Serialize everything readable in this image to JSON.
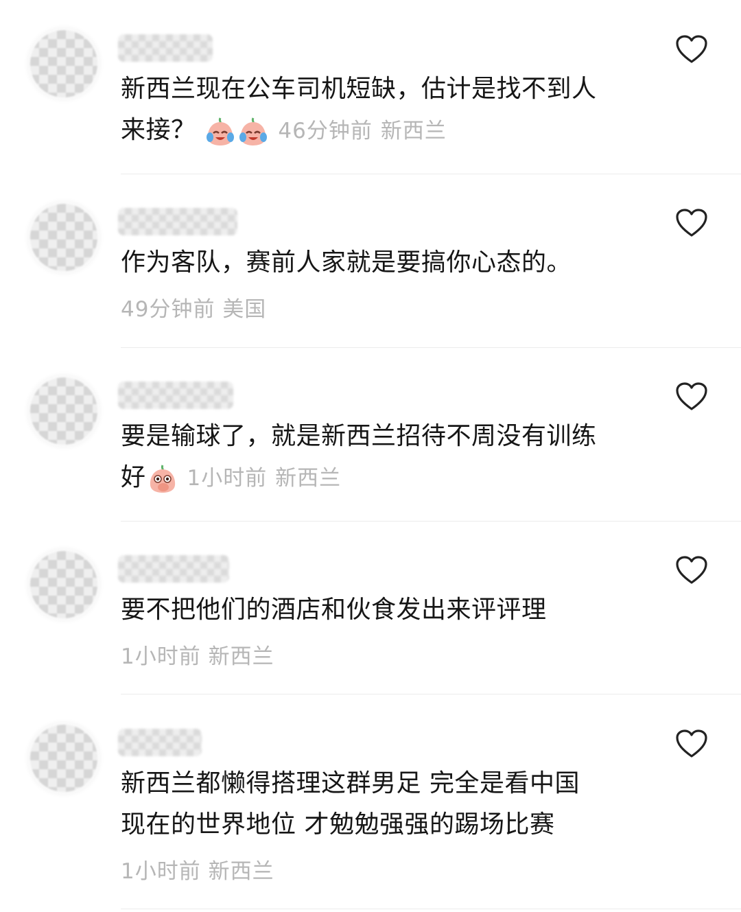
{
  "comments": [
    {
      "text": "新西兰现在公车司机短缺，估计是找不到人来接？",
      "text_line1": "新西兰现在公车司机短缺，估计是找不到人",
      "text_line2": "来接？",
      "emojis": [
        "crying-laughing-peach-icon",
        "crying-laughing-peach-icon"
      ],
      "time": "46分钟前",
      "location": "新西兰"
    },
    {
      "text": "作为客队，赛前人家就是要搞你心态的。",
      "time": "49分钟前",
      "location": "美国"
    },
    {
      "text": "要是输球了，就是新西兰招待不周没有训练好",
      "text_line1": "要是输球了，就是新西兰招待不周没有训练",
      "text_line2": "好",
      "emojis": [
        "covering-mouth-peach-icon"
      ],
      "time": "1小时前",
      "location": "新西兰"
    },
    {
      "text": "要不把他们的酒店和伙食发出来评评理",
      "time": "1小时前",
      "location": "新西兰"
    },
    {
      "text": "新西兰都懒得搭理这群男足 完全是看中国现在的世界地位 才勉勉强强的踢场比赛",
      "text_line1": "新西兰都懒得搭理这群男足 完全是看中国",
      "text_line2": "现在的世界地位 才勉勉强强的踢场比赛",
      "time": "1小时前",
      "location": "新西兰"
    }
  ],
  "colors": {
    "text": "#161616",
    "meta": "#b6b6b6",
    "divider": "#ececec",
    "heart": "#222222"
  }
}
